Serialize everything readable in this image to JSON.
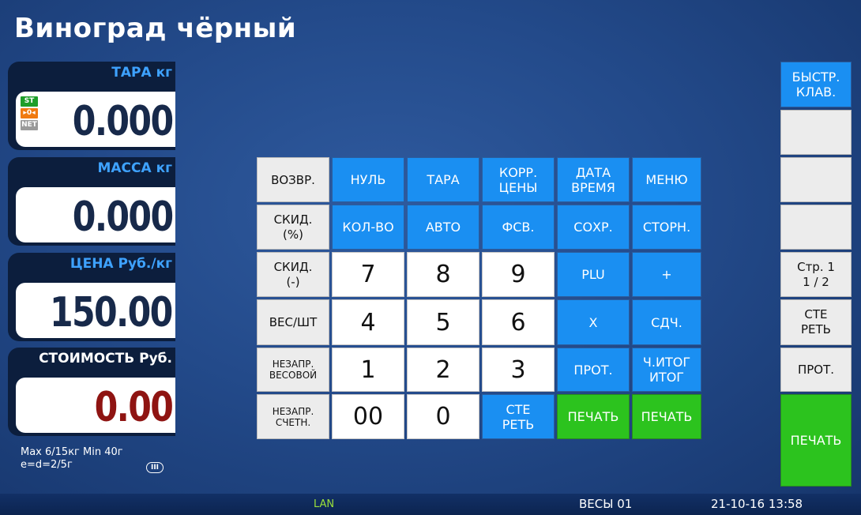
{
  "product_name": "Виноград чёрный",
  "panels": {
    "tare": {
      "label": "ТАРА кг",
      "value": "0.000"
    },
    "weight": {
      "label": "МАССА кг",
      "value": "0.000"
    },
    "price": {
      "label": "ЦЕНА Руб./кг",
      "value": "150.00"
    },
    "total": {
      "label": "СТОИМОСТЬ Руб.",
      "value": "0.00"
    }
  },
  "indicators": {
    "stable": "ST",
    "zero": "▸0◂",
    "net": "NET"
  },
  "specs": {
    "line1": "Max 6/15кг Min 40г",
    "line2": "e=d=2/5г",
    "class_mark": "III"
  },
  "keypad": {
    "row1": [
      "ВОЗВР.",
      "НУЛЬ",
      "ТАРА",
      "КОРР.\nЦЕНЫ",
      "ДАТА\nВРЕМЯ",
      "МЕНЮ"
    ],
    "row2": [
      "СКИД.\n(%)",
      "КОЛ-ВО",
      "АВТО",
      "ФСВ.",
      "СОХР.",
      "СТОРН."
    ],
    "row3": [
      "СКИД.\n(-)",
      "7",
      "8",
      "9",
      "PLU",
      "+"
    ],
    "row4": [
      "ВЕС/ШТ",
      "4",
      "5",
      "6",
      "X",
      "СДЧ."
    ],
    "row5": [
      "НЕЗАПР.\nВЕСОВОЙ",
      "1",
      "2",
      "3",
      "ПРОТ.",
      "Ч.ИТОГ\nИТОГ"
    ],
    "row6": [
      "НЕЗАПР.\nСЧЕТН.",
      "00",
      "0",
      "СТЕ\nРЕТЬ",
      "ПЕЧАТЬ",
      "ПЕЧАТЬ"
    ]
  },
  "sidebar": {
    "quick_keys": "БЫСТР.\nКЛАВ.",
    "page": "Стр. 1\n1 / 2",
    "erase": "СТЕ\nРЕТЬ",
    "protocol": "ПРОТ.",
    "print": "ПЕЧАТЬ"
  },
  "status": {
    "network": "LAN",
    "scale_id": "ВЕСЫ 01",
    "datetime": "21-10-16 13:58"
  },
  "colors": {
    "accent_blue": "#1a8ff2",
    "green": "#2cc31e",
    "label_blue": "#3ea2ff",
    "total_red": "#8f1412"
  }
}
